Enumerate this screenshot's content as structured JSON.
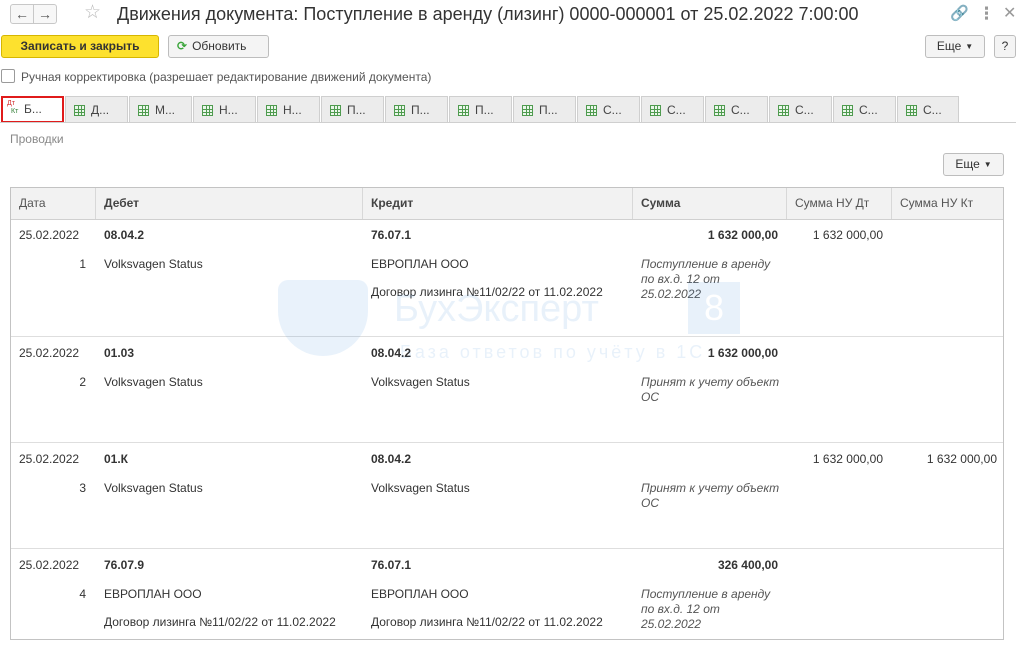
{
  "window": {
    "title": "Движения документа: Поступление в аренду (лизинг) 0000-000001 от 25.02.2022 7:00:00",
    "icons": [
      "back-arrow-icon",
      "forward-arrow-icon",
      "star-icon",
      "link-icon",
      "more-vertical-icon",
      "close-icon"
    ]
  },
  "toolbar": {
    "save_close_label": "Записать и закрыть",
    "refresh_label": "Обновить",
    "more_label": "Еще",
    "help_label": "?"
  },
  "manual_edit": {
    "checked": false,
    "label": "Ручная корректировка (разрешает редактирование движений документа)"
  },
  "tabs": [
    {
      "label": "Б...",
      "icon": "dt-kt-icon",
      "active": true
    },
    {
      "label": "Д...",
      "icon": "register-grid-icon",
      "active": false
    },
    {
      "label": "М...",
      "icon": "register-grid-icon",
      "active": false
    },
    {
      "label": "Н...",
      "icon": "register-grid-icon",
      "active": false
    },
    {
      "label": "Н...",
      "icon": "register-grid-icon",
      "active": false
    },
    {
      "label": "П...",
      "icon": "register-grid-icon",
      "active": false
    },
    {
      "label": "П...",
      "icon": "register-grid-icon",
      "active": false
    },
    {
      "label": "П...",
      "icon": "register-grid-icon",
      "active": false
    },
    {
      "label": "П...",
      "icon": "register-grid-icon",
      "active": false
    },
    {
      "label": "С...",
      "icon": "register-grid-icon",
      "active": false
    },
    {
      "label": "С...",
      "icon": "register-grid-icon",
      "active": false
    },
    {
      "label": "С...",
      "icon": "register-grid-icon",
      "active": false
    },
    {
      "label": "С...",
      "icon": "register-grid-icon",
      "active": false
    },
    {
      "label": "С...",
      "icon": "register-grid-icon",
      "active": false
    },
    {
      "label": "С...",
      "icon": "register-grid-icon",
      "active": false
    }
  ],
  "section": {
    "label": "Проводки",
    "more_label": "Еще"
  },
  "table": {
    "columns": {
      "date": "Дата",
      "debit": "Дебет",
      "credit": "Кредит",
      "sum": "Сумма",
      "nu_dt": "Сумма НУ Дт",
      "nu_kt": "Сумма НУ Кт"
    },
    "rows": [
      {
        "date": "25.02.2022",
        "num": "1",
        "debit_account": "08.04.2",
        "debit_sub1": "Volksvagen Status",
        "debit_sub2": "",
        "credit_account": "76.07.1",
        "credit_sub1": "ЕВРОПЛАН ООО",
        "credit_sub2": "Договор лизинга №11/02/22 от 11.02.2022",
        "sum": "1 632 000,00",
        "content": "Поступление в аренду по вх.д. 12 от 25.02.2022",
        "nu_dt": "1 632 000,00",
        "nu_kt": ""
      },
      {
        "date": "25.02.2022",
        "num": "2",
        "debit_account": "01.03",
        "debit_sub1": "Volksvagen Status",
        "debit_sub2": "",
        "credit_account": "08.04.2",
        "credit_sub1": "Volksvagen Status",
        "credit_sub2": "",
        "sum": "1 632 000,00",
        "content": "Принят к учету объект ОС",
        "nu_dt": "",
        "nu_kt": ""
      },
      {
        "date": "25.02.2022",
        "num": "3",
        "debit_account": "01.К",
        "debit_sub1": "Volksvagen Status",
        "debit_sub2": "",
        "credit_account": "08.04.2",
        "credit_sub1": "Volksvagen Status",
        "credit_sub2": "",
        "sum": "",
        "content": "Принят к учету объект ОС",
        "nu_dt": "1 632 000,00",
        "nu_kt": "1 632 000,00"
      },
      {
        "date": "25.02.2022",
        "num": "4",
        "debit_account": "76.07.9",
        "debit_sub1": "ЕВРОПЛАН ООО",
        "debit_sub2": "Договор лизинга №11/02/22 от 11.02.2022",
        "credit_account": "76.07.1",
        "credit_sub1": "ЕВРОПЛАН ООО",
        "credit_sub2": "Договор лизинга №11/02/22 от 11.02.2022",
        "sum": "326 400,00",
        "content": "Поступление в аренду по вх.д. 12 от 25.02.2022",
        "nu_dt": "",
        "nu_kt": ""
      }
    ]
  },
  "watermark": {
    "line1": "БухЭксперт",
    "badge": "8",
    "line2": "База ответов по учёту в 1С"
  }
}
